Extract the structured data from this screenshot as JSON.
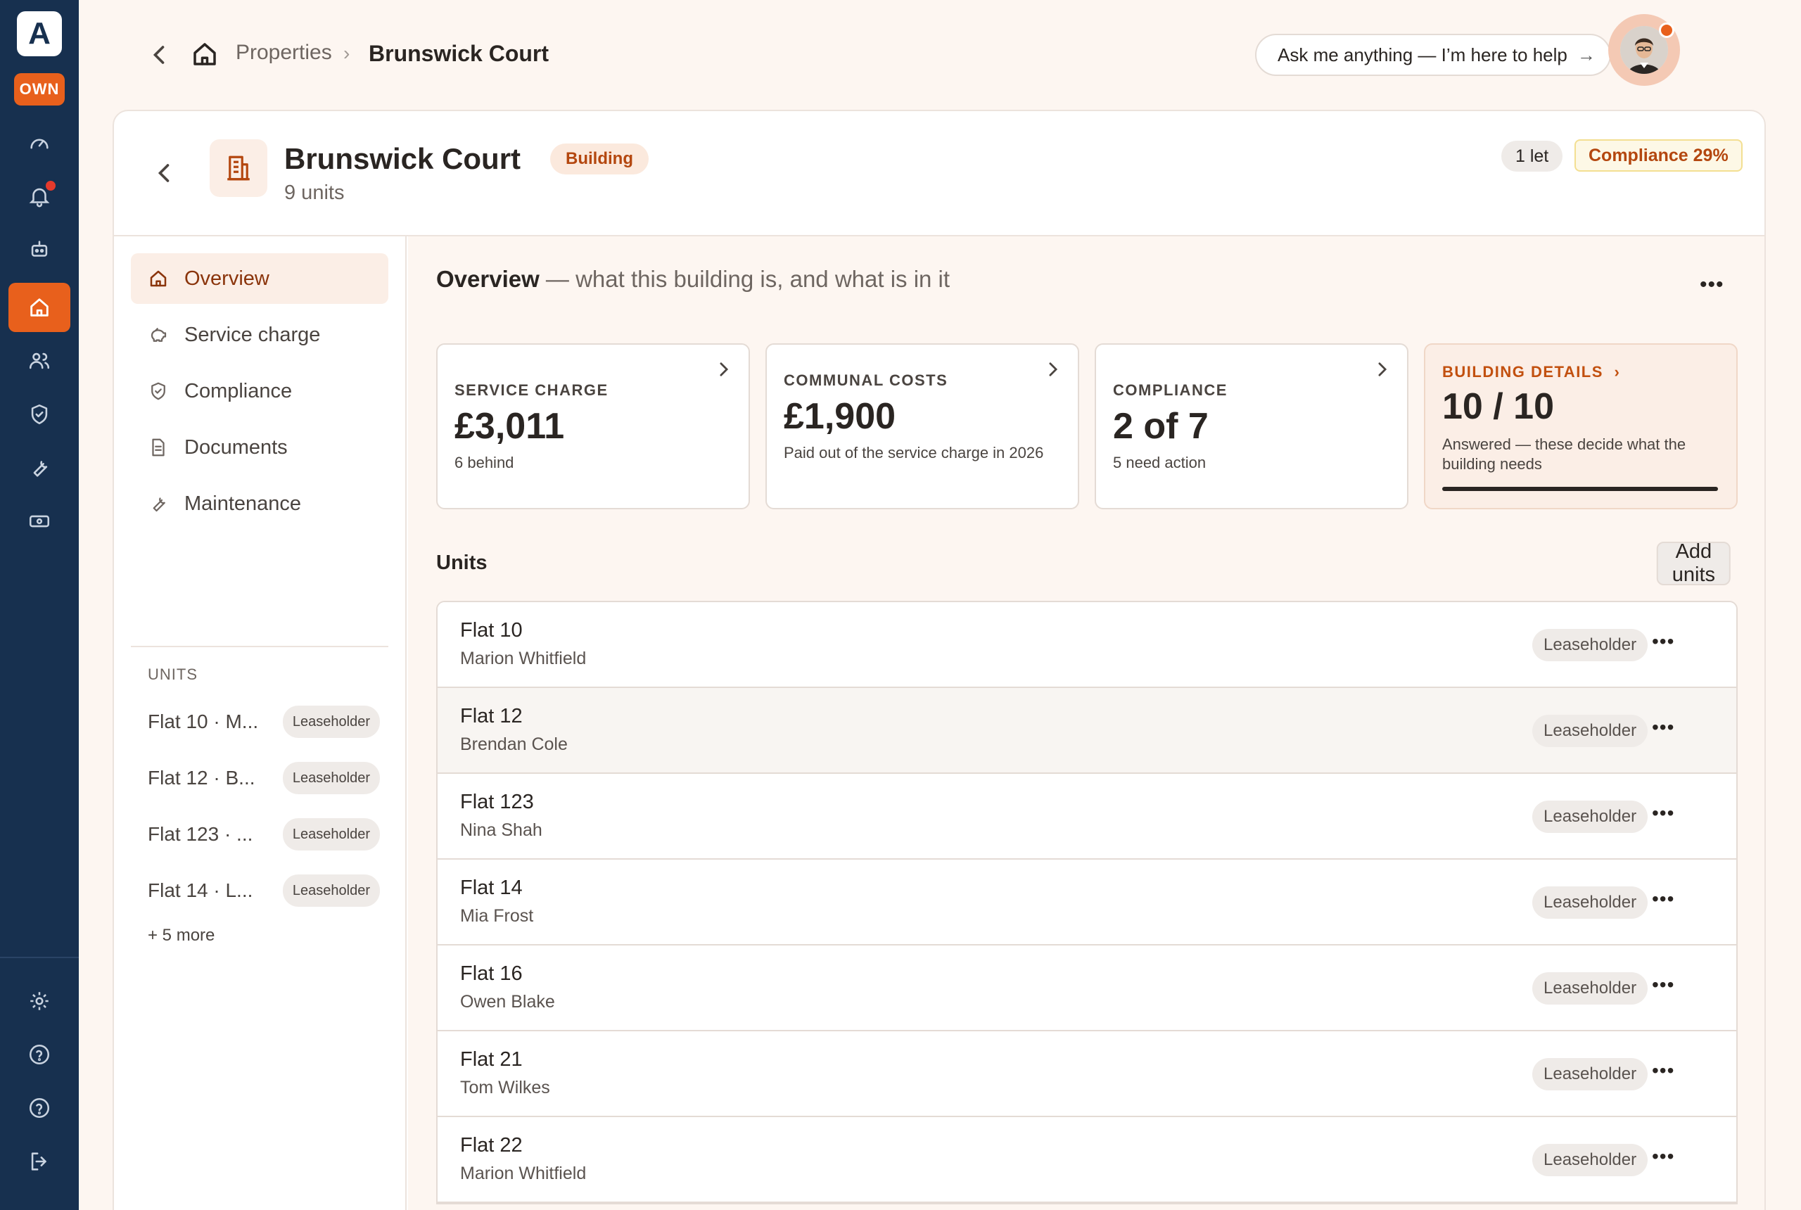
{
  "rail": {
    "logo_letter": "A",
    "own_label": "OWN",
    "colors": {
      "bg": "#17304f",
      "accent": "#e8601c"
    }
  },
  "topbar": {
    "breadcrumb": {
      "parent": "Properties",
      "current": "Brunswick Court"
    },
    "ask_label": "Ask me anything — I’m here to help",
    "ask_arrow": "→"
  },
  "building": {
    "title": "Brunswick Court",
    "subtitle": "9 units",
    "type_badge": "Building",
    "let_pill": "1 let",
    "compliance_pill": "Compliance 29%"
  },
  "sidenav": {
    "items": [
      {
        "label": "Overview",
        "icon": "home-icon"
      },
      {
        "label": "Service charge",
        "icon": "piggy-bank-icon"
      },
      {
        "label": "Compliance",
        "icon": "shield-check-icon"
      },
      {
        "label": "Documents",
        "icon": "document-icon"
      },
      {
        "label": "Maintenance",
        "icon": "wrench-icon"
      }
    ],
    "units_label": "UNITS",
    "units": [
      {
        "name": "Flat 10 · M...",
        "tag": "Leaseholder"
      },
      {
        "name": "Flat 12 · B...",
        "tag": "Leaseholder"
      },
      {
        "name": "Flat 123 · ...",
        "tag": "Leaseholder"
      },
      {
        "name": "Flat 14 · L...",
        "tag": "Leaseholder"
      }
    ],
    "more": "+ 5 more"
  },
  "overview": {
    "title": "Overview",
    "subtitle": " — what this building is, and what is in it",
    "menu": "•••"
  },
  "stats": [
    {
      "label": "SERVICE CHARGE",
      "value": "£3,011",
      "sub": "6 behind"
    },
    {
      "label": "COMMUNAL COSTS",
      "value": "£1,900",
      "sub": "Paid out of the service charge in 2026"
    },
    {
      "label": "COMPLIANCE",
      "value": "2 of 7",
      "sub": "5 need action"
    },
    {
      "label": "BUILDING DETAILS",
      "value": "10 / 10",
      "sub": "Answered — these decide what the building needs",
      "progress": 1.0
    }
  ],
  "units": {
    "heading": "Units",
    "add_label": "Add units",
    "rows": [
      {
        "flat": "Flat 10",
        "owner": "Marion Whitfield",
        "tag": "Leaseholder"
      },
      {
        "flat": "Flat 12",
        "owner": "Brendan Cole",
        "tag": "Leaseholder"
      },
      {
        "flat": "Flat 123",
        "owner": "Nina Shah",
        "tag": "Leaseholder"
      },
      {
        "flat": "Flat 14",
        "owner": "Mia Frost",
        "tag": "Leaseholder"
      },
      {
        "flat": "Flat 16",
        "owner": "Owen Blake",
        "tag": "Leaseholder"
      },
      {
        "flat": "Flat 21",
        "owner": "Tom Wilkes",
        "tag": "Leaseholder"
      },
      {
        "flat": "Flat 22",
        "owner": "Marion Whitfield",
        "tag": "Leaseholder"
      }
    ],
    "row_menu": "•••"
  }
}
